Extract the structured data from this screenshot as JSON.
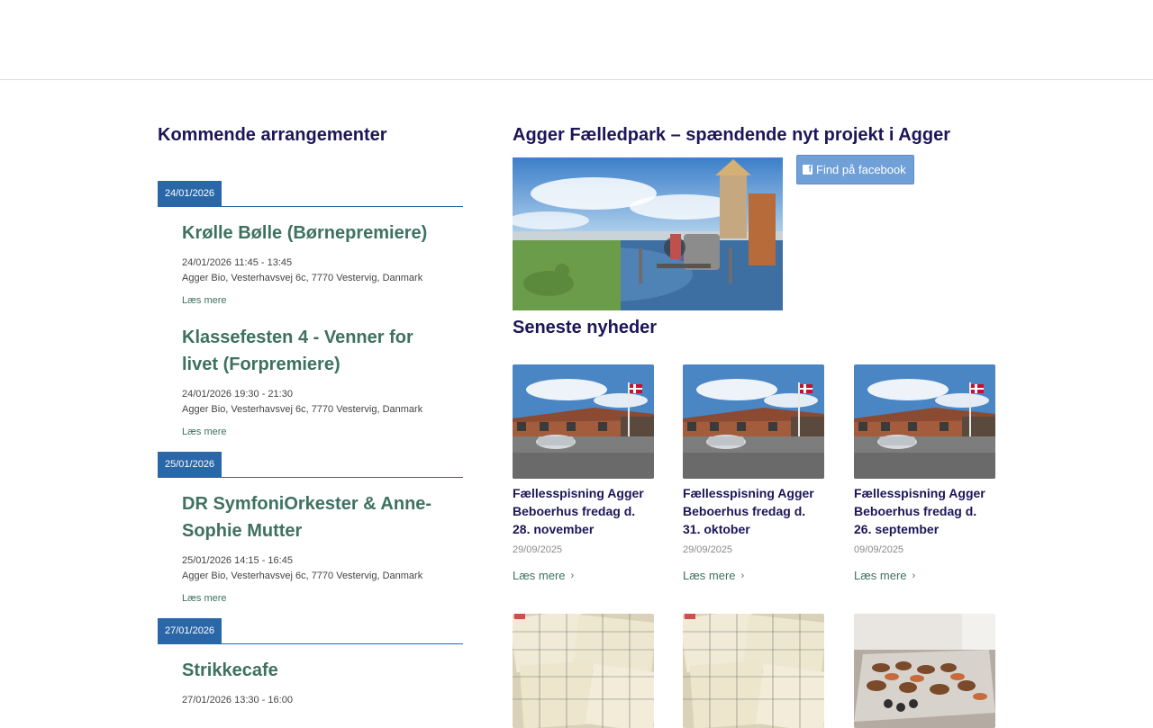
{
  "events": {
    "heading": "Kommende arrangementer",
    "groups": [
      {
        "date": "24/01/2026",
        "items": [
          {
            "title": "Krølle Bølle (Børnepremiere)",
            "datetime": "24/01/2026  11:45 - 13:45",
            "location": "Agger Bio, Vesterhavsvej 6c, 7770 Vestervig, Danmark",
            "more": "Læs mere"
          },
          {
            "title": "Klassefesten 4 - Venner for livet (Forpremiere)",
            "datetime": "24/01/2026  19:30 - 21:30",
            "location": "Agger Bio, Vesterhavsvej 6c, 7770 Vestervig, Danmark",
            "more": "Læs mere"
          }
        ]
      },
      {
        "date": "25/01/2026",
        "items": [
          {
            "title": "DR SymfoniOrkester & Anne-Sophie Mutter",
            "datetime": "25/01/2026  14:15 - 16:45",
            "location": "Agger Bio, Vesterhavsvej 6c, 7770 Vestervig, Danmark",
            "more": "Læs mere"
          }
        ]
      },
      {
        "date": "27/01/2026",
        "items": [
          {
            "title": "Strikkecafe",
            "datetime": "27/01/2026  13:30 - 16:00",
            "location": "",
            "more": ""
          }
        ]
      }
    ]
  },
  "feature": {
    "title": "Agger Fælledpark – spændende nyt projekt i Agger",
    "facebook_label": "Find på facebook"
  },
  "news": {
    "heading": "Seneste nyheder",
    "cards": [
      {
        "title": "Fællesspisning Agger Beboerhus fredag d. 28. november",
        "date": "29/09/2025",
        "more": "Læs mere",
        "image": "house"
      },
      {
        "title": "Fællesspisning Agger Beboerhus fredag d. 31. oktober",
        "date": "29/09/2025",
        "more": "Læs mere",
        "image": "house"
      },
      {
        "title": "Fællesspisning Agger Beboerhus fredag d. 26. september",
        "date": "09/09/2025",
        "more": "Læs mere",
        "image": "house"
      },
      {
        "title": "",
        "date": "",
        "more": "",
        "image": "bingo"
      },
      {
        "title": "",
        "date": "",
        "more": "",
        "image": "bingo"
      },
      {
        "title": "",
        "date": "",
        "more": "",
        "image": "buffet"
      }
    ]
  },
  "colors": {
    "heading": "#1c1557",
    "accent_green": "#3e7160",
    "date_tag": "#2a67a8",
    "facebook_button": "#6fa0d8"
  }
}
